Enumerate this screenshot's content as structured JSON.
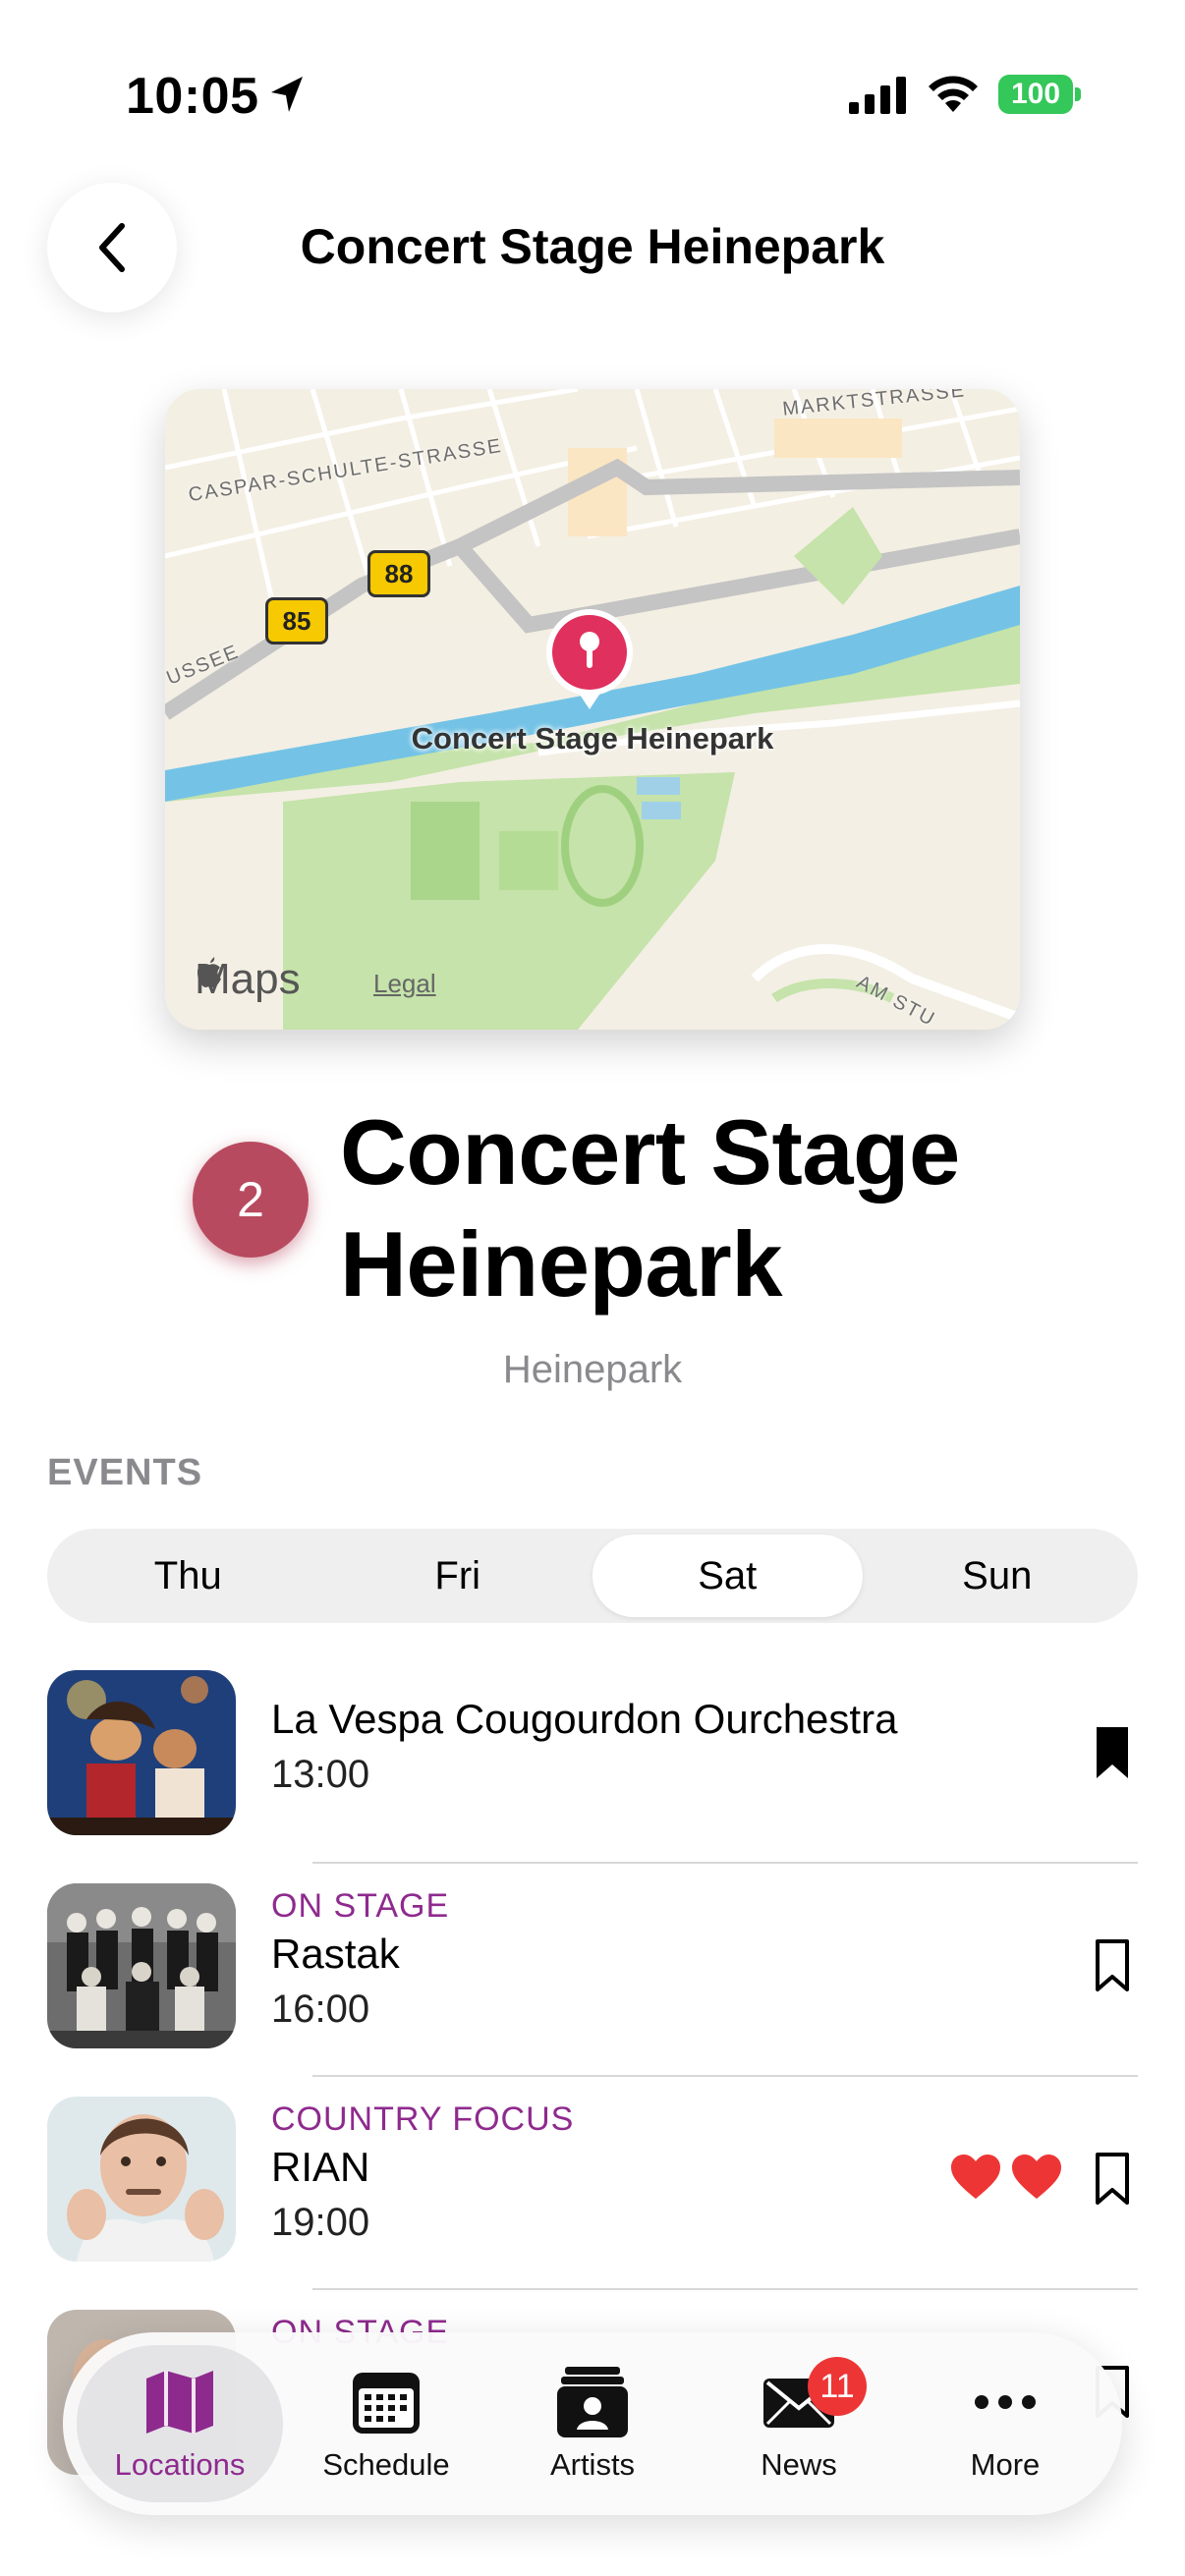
{
  "status_bar": {
    "time": "10:05",
    "battery": "100"
  },
  "nav": {
    "title": "Concert Stage Heinepark"
  },
  "map": {
    "pin_label": "Concert Stage Heinepark",
    "streets": [
      "MARKTSTRASSE",
      "CASPAR-SCHULTE-STRASSE",
      "USSEE",
      "AM STU"
    ],
    "route_numbers": [
      "88",
      "85"
    ],
    "maps_text": "Maps",
    "legal": "Legal"
  },
  "place": {
    "number": "2",
    "title": "Concert Stage Heinepark",
    "subtitle": "Heinepark",
    "color": "#b84a5f"
  },
  "events": {
    "header": "EVENTS",
    "days": [
      "Thu",
      "Fri",
      "Sat",
      "Sun"
    ],
    "selected_day": "Sat",
    "items": [
      {
        "tag": "",
        "name": "La Vespa Cougourdon Ourchestra",
        "time": "13:00",
        "bookmarked": true,
        "hearts": 0
      },
      {
        "tag": "ON STAGE",
        "name": "Rastak",
        "time": "16:00",
        "bookmarked": false,
        "hearts": 0
      },
      {
        "tag": "COUNTRY FOCUS",
        "name": "RIAN",
        "time": "19:00",
        "bookmarked": false,
        "hearts": 2
      },
      {
        "tag": "ON STAGE",
        "name": "",
        "time": "",
        "bookmarked": false,
        "hearts": 0
      }
    ],
    "tag_color": "#8e2a8e"
  },
  "tab_bar": {
    "items": [
      {
        "label": "Locations",
        "icon": "map-icon",
        "active": true
      },
      {
        "label": "Schedule",
        "icon": "calendar-icon",
        "active": false
      },
      {
        "label": "Artists",
        "icon": "person-card-icon",
        "active": false
      },
      {
        "label": "News",
        "icon": "envelope-icon",
        "active": false,
        "badge": "11"
      },
      {
        "label": "More",
        "icon": "ellipsis-icon",
        "active": false
      }
    ]
  }
}
